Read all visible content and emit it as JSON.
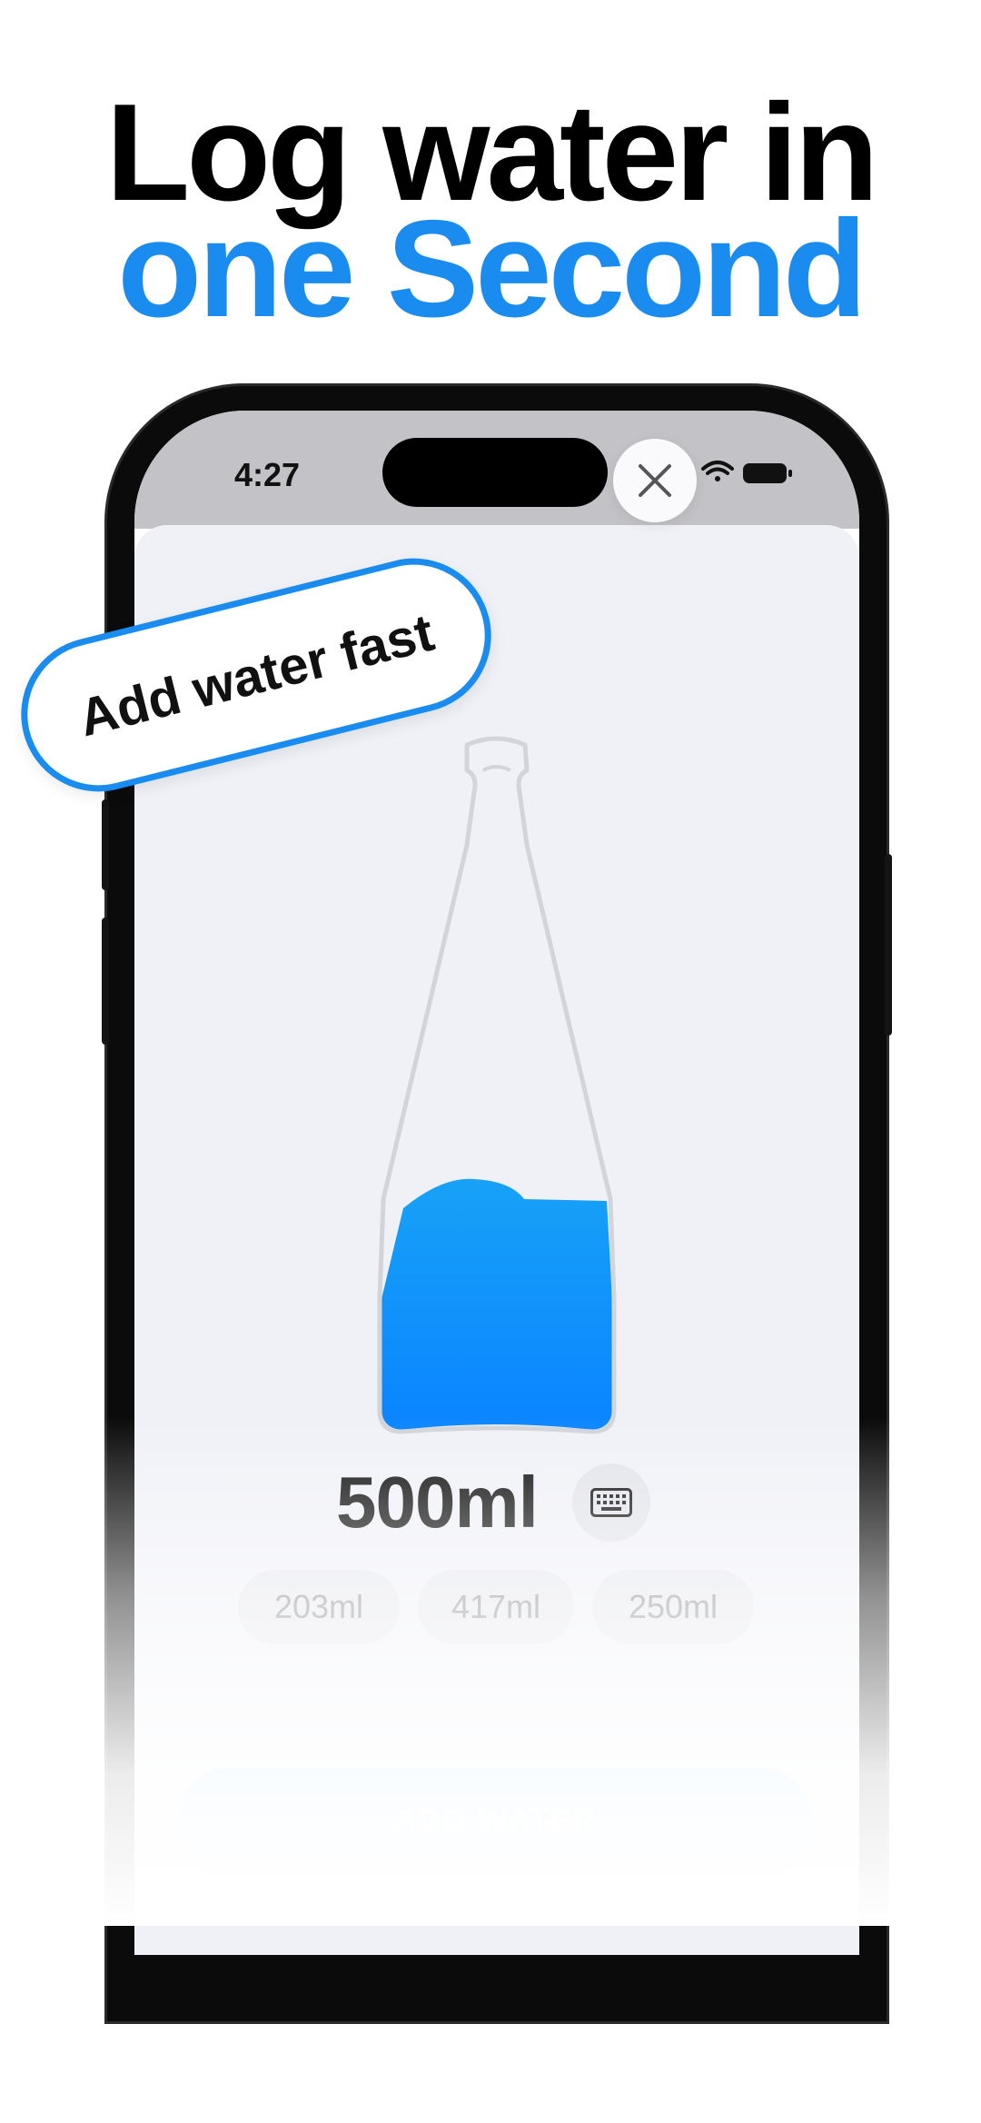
{
  "headline": {
    "line1": "Log water in",
    "line2": "one Second"
  },
  "status_bar": {
    "time": "4:27"
  },
  "callout": {
    "text": "Add water fast"
  },
  "amount": {
    "value": "500ml"
  },
  "presets": [
    "203ml",
    "417ml",
    "250ml"
  ],
  "add_button": {
    "label": "ADD WATER"
  },
  "bottle": {
    "fill_fraction": 0.32
  },
  "colors": {
    "accent": "#1a8cf0",
    "water_top": "#17a2f7",
    "water_bottom": "#0a84ff"
  },
  "icons": {
    "close": "close-icon",
    "keyboard": "keyboard-icon",
    "wifi": "wifi-icon",
    "battery": "battery-icon",
    "signal": "signal-icon"
  }
}
